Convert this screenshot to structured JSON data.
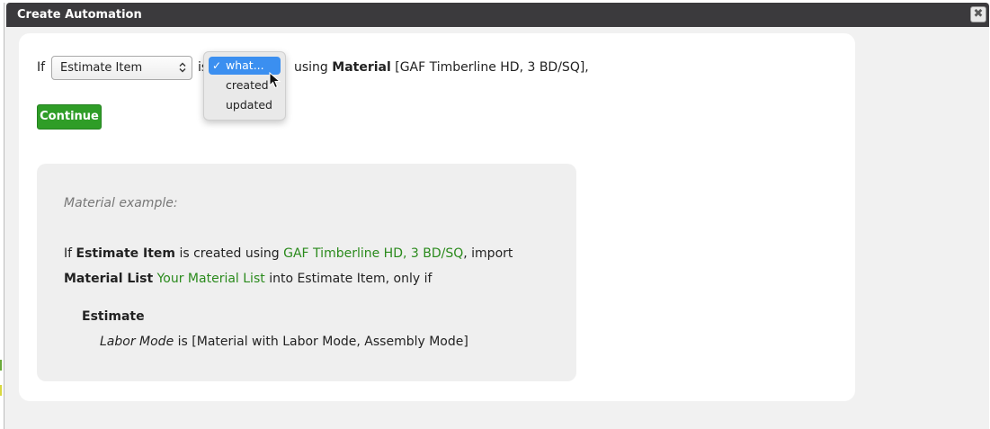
{
  "window": {
    "title": "Create Automation",
    "close_glyph": "✖"
  },
  "rule": {
    "if_label": "If",
    "entity_select_value": "Estimate Item",
    "is_label": "is",
    "using_label": "using",
    "material_label": "Material",
    "material_value": "[GAF Timberline HD, 3 BD/SQ],"
  },
  "event_dropdown": {
    "options": [
      {
        "label": "what...",
        "selected": true
      },
      {
        "label": "created",
        "selected": false
      },
      {
        "label": "updated",
        "selected": false
      }
    ],
    "check_glyph": "✓"
  },
  "continue_button": "Continue",
  "example": {
    "title": "Material example:",
    "line1_prefix": "If",
    "line1_entity": "Estimate Item",
    "line1_middle": "is created using",
    "line1_material": "GAF Timberline HD, 3 BD/SQ",
    "line1_suffix": ", import",
    "line2_type": "Material List",
    "line2_list": "Your Material List",
    "line2_suffix": "into Estimate Item, only if",
    "section_heading": "Estimate",
    "condition_field": "Labor Mode",
    "condition_rest": "is [Material with Labor Mode, Assembly Mode]"
  },
  "colors": {
    "titlebar": "#3b3a3d",
    "continue": "#2f9d27",
    "link_green": "#2a8a1c",
    "option_highlight": "#3b8ff0"
  },
  "icons": {
    "close": "close-icon",
    "chevron": "chevron-updown-icon",
    "check": "checkmark-icon",
    "cursor": "mouse-pointer-icon"
  }
}
